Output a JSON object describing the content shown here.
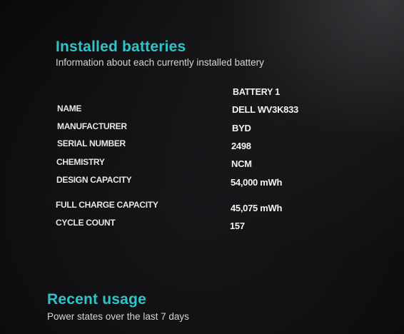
{
  "installed": {
    "title": "Installed batteries",
    "subtitle": "Information about each currently installed battery",
    "column_header": "BATTERY 1",
    "rows": [
      {
        "label": "NAME",
        "value": "DELL WV3K833"
      },
      {
        "label": "MANUFACTURER",
        "value": "BYD"
      },
      {
        "label": "SERIAL NUMBER",
        "value": "2498"
      },
      {
        "label": "CHEMISTRY",
        "value": "NCM"
      },
      {
        "label": "DESIGN CAPACITY",
        "value": "54,000 mWh"
      },
      {
        "label": "FULL CHARGE CAPACITY",
        "value": "45,075 mWh"
      },
      {
        "label": "CYCLE COUNT",
        "value": "157"
      }
    ]
  },
  "recent": {
    "title": "Recent usage",
    "subtitle": "Power states over the last 7 days"
  },
  "colors": {
    "accent": "#2ec4c9",
    "background": "#101012",
    "text": "#e8e8e8"
  }
}
